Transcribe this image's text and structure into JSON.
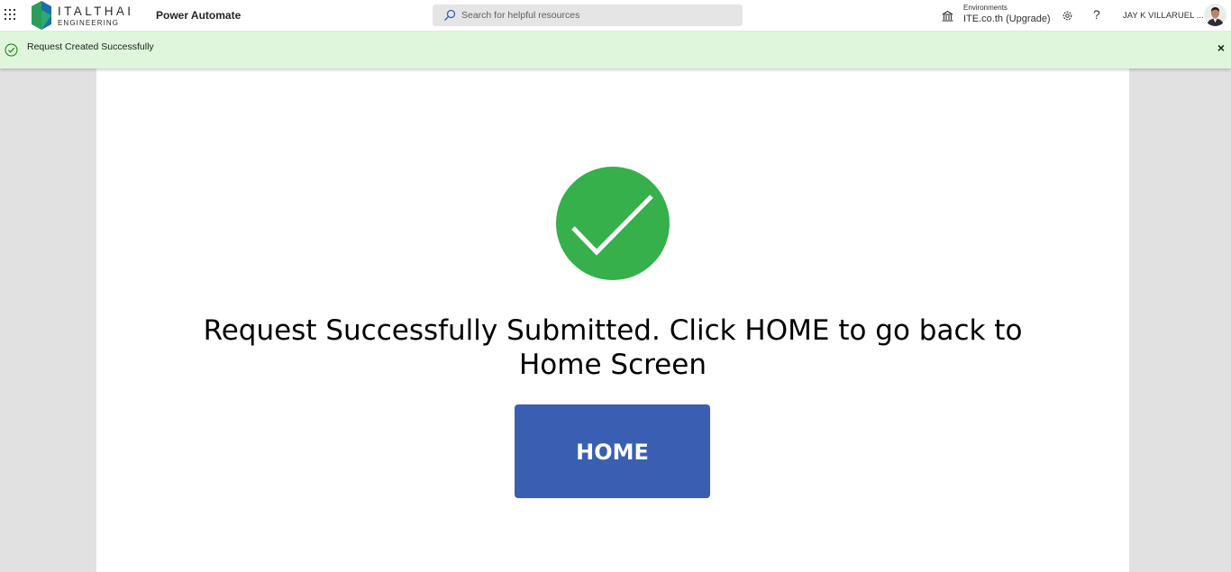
{
  "header": {
    "waffle_icon": "app-launcher-icon",
    "logo": {
      "name": "ITALTHAI",
      "subtitle": "ENGINEERING",
      "colors": [
        "#2a9d5c",
        "#1b6fa8"
      ]
    },
    "app_name": "Power Automate",
    "search": {
      "placeholder": "Search for helpful resources",
      "icon": "search-icon"
    },
    "environment": {
      "label": "Environments",
      "value": "ITE.co.th (Upgrade)",
      "icon": "environment-icon"
    },
    "settings_icon": "gear-icon",
    "help_icon": "?",
    "user_name": "JAY K VILLARUEL ..."
  },
  "notification": {
    "text": "Request Created Successfully",
    "status_color": "#107c10",
    "background": "#dff6dd",
    "close_label": "×"
  },
  "main": {
    "success_icon": "checkmark-circle-icon",
    "success_color": "#35b04a",
    "message": "Request Successfully Submitted. Click HOME to go back to Home Screen",
    "home_button": {
      "label": "HOME",
      "color": "#3a5fb2"
    }
  }
}
